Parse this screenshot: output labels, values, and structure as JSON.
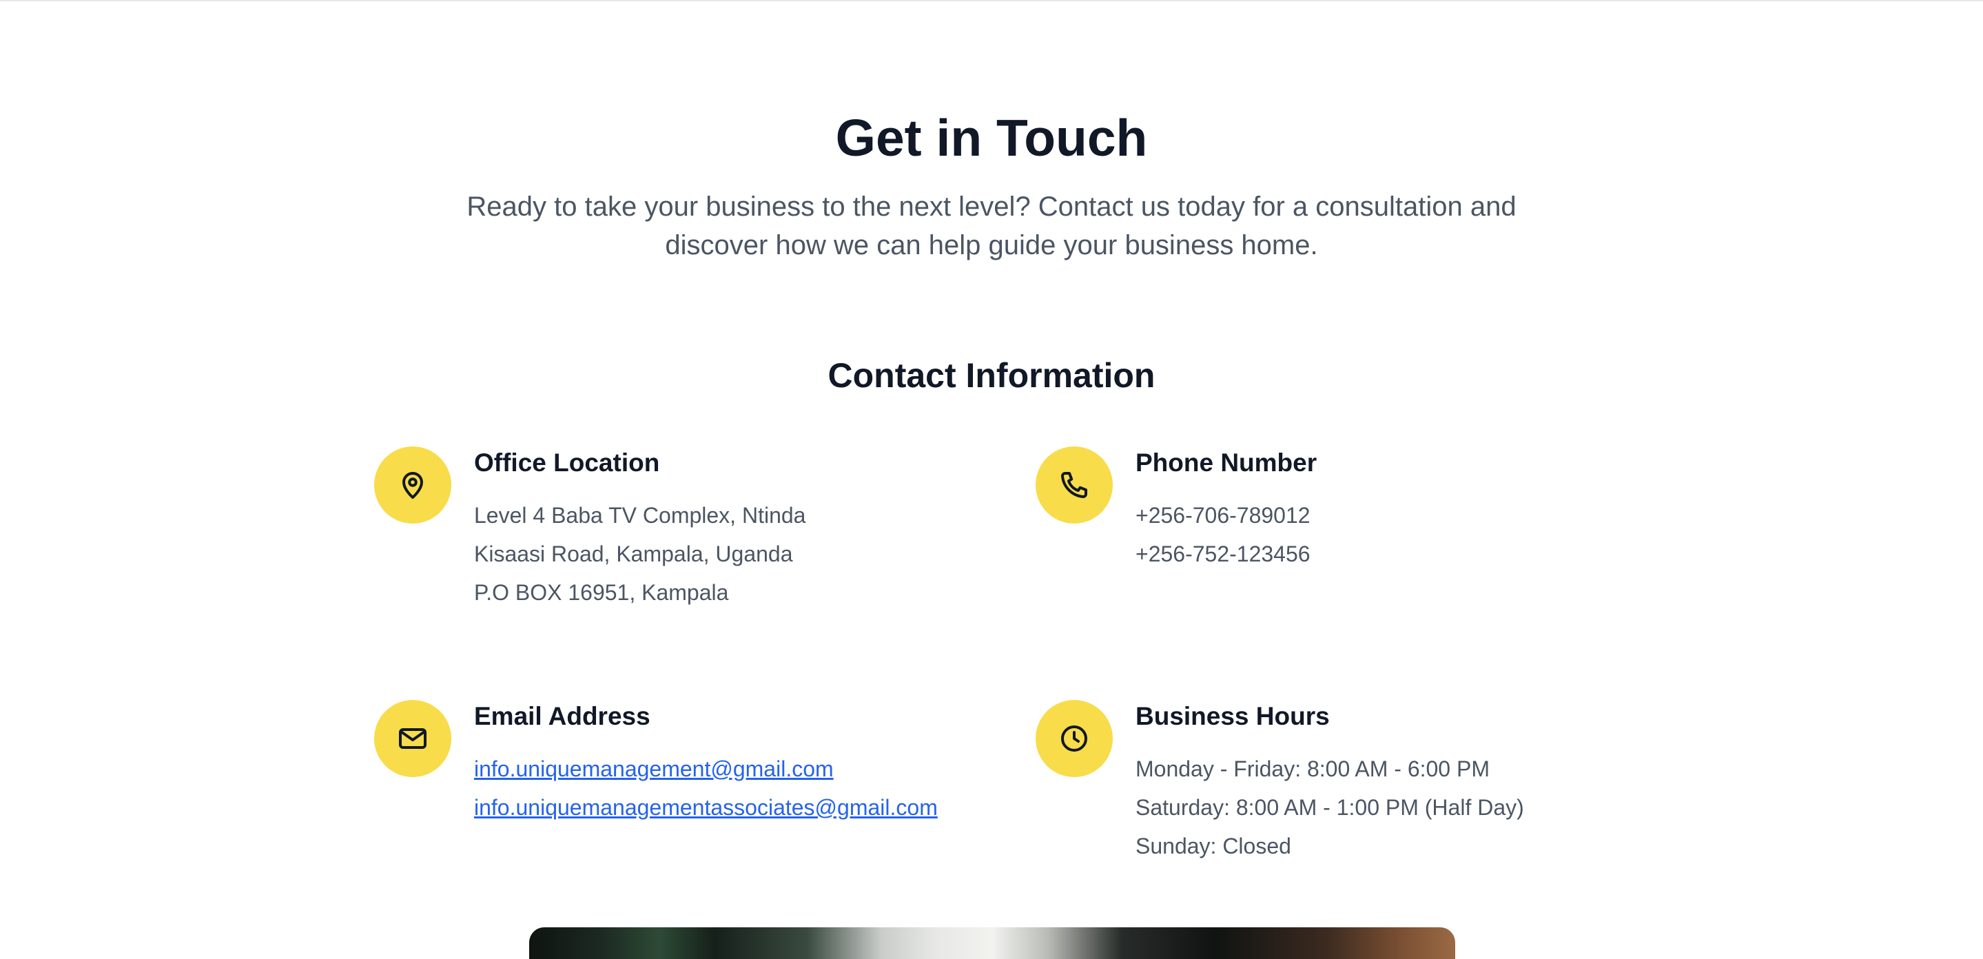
{
  "hero": {
    "title": "Get in Touch",
    "subtitle": "Ready to take your business to the next level? Contact us today for a consultation and discover how we can help guide your business home."
  },
  "contact": {
    "section_title": "Contact Information",
    "office": {
      "icon": "map-pin-icon",
      "title": "Office Location",
      "lines": [
        "Level 4 Baba TV Complex, Ntinda",
        "Kisaasi Road, Kampala, Uganda",
        "P.O BOX 16951, Kampala"
      ]
    },
    "phone": {
      "icon": "phone-icon",
      "title": "Phone Number",
      "lines": [
        "+256-706-789012",
        "+256-752-123456"
      ]
    },
    "email": {
      "icon": "mail-icon",
      "title": "Email Address",
      "links": [
        "info.uniquemanagement@gmail.com",
        "info.uniquemanagementassociates@gmail.com"
      ]
    },
    "hours": {
      "icon": "clock-icon",
      "title": "Business Hours",
      "lines": [
        "Monday - Friday: 8:00 AM - 6:00 PM",
        "Saturday: 8:00 AM - 1:00 PM (Half Day)",
        "Sunday: Closed"
      ]
    }
  },
  "colors": {
    "accent": "#f8dc4a",
    "heading": "#111827",
    "body_text": "#4b5563",
    "link": "#2563eb"
  }
}
